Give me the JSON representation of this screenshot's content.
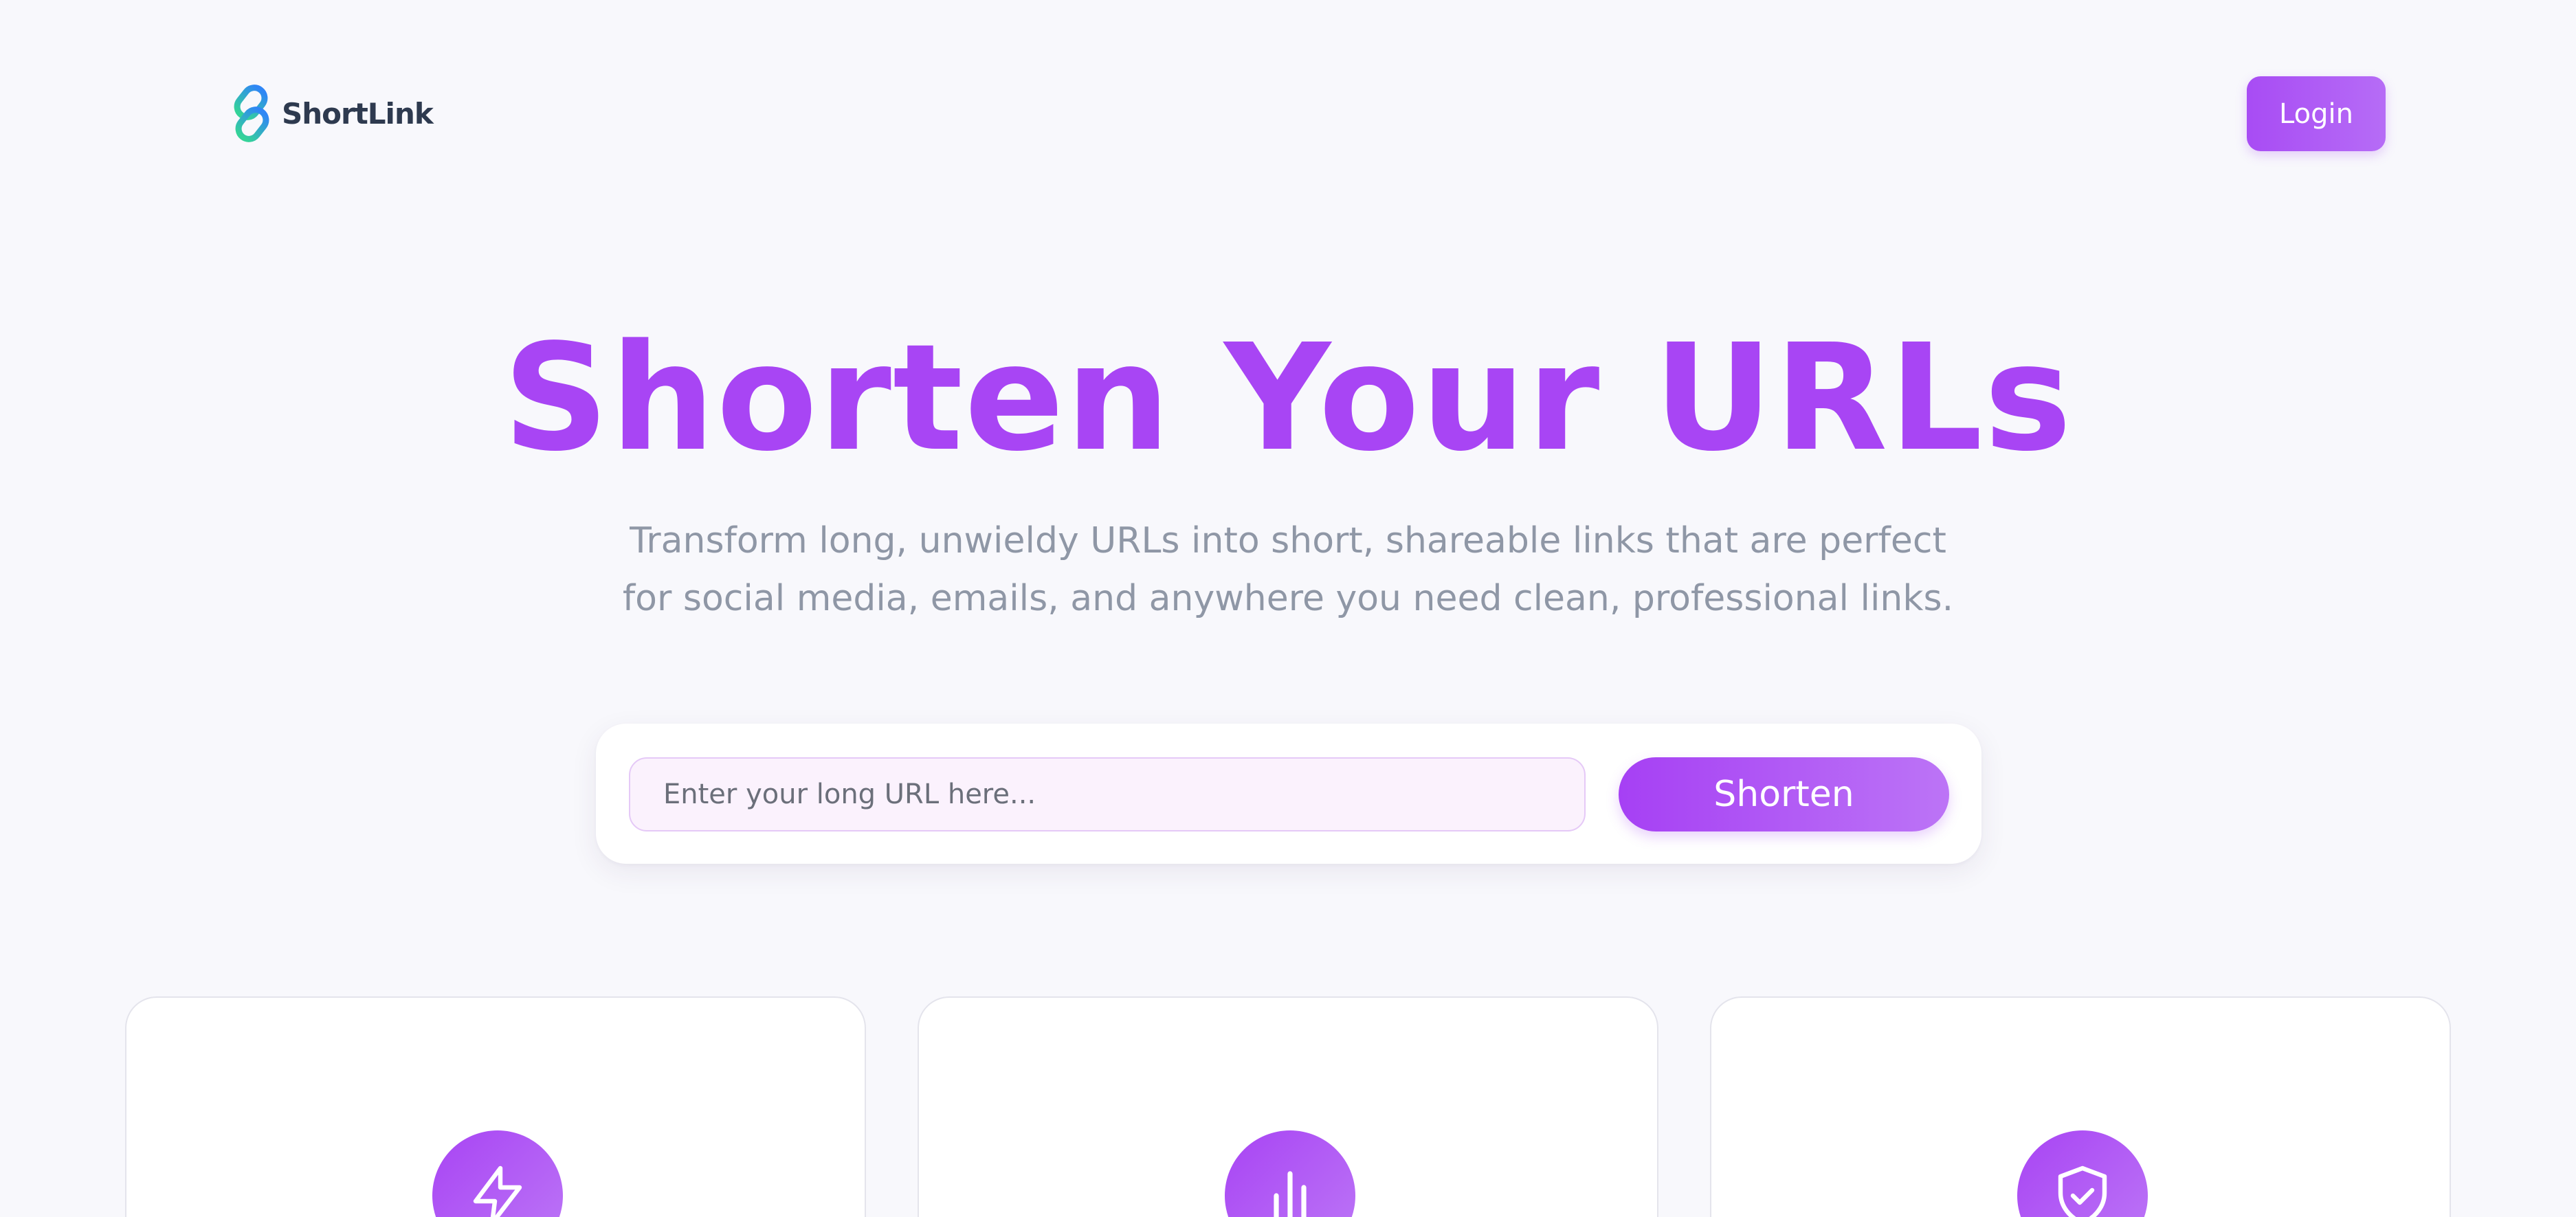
{
  "brand": {
    "name": "ShortLink",
    "logo_icon": "link-chain-icon",
    "colors": {
      "accent": "#a845f4",
      "logo_blue": "#2f86f6",
      "logo_green": "#34d399",
      "text_dark": "#2e3a4f",
      "text_muted": "#8f97a6"
    }
  },
  "header": {
    "login_label": "Login"
  },
  "hero": {
    "title": "Shorten Your URLs",
    "subtitle": "Transform long, unwieldy URLs into short, shareable links that are perfect for social media, emails, and anywhere you need clean, professional links."
  },
  "shorten_form": {
    "input_value": "",
    "input_placeholder": "Enter your long URL here...",
    "button_label": "Shorten"
  },
  "features": [
    {
      "icon": "lightning-bolt-icon"
    },
    {
      "icon": "bar-chart-icon"
    },
    {
      "icon": "shield-check-icon"
    }
  ]
}
